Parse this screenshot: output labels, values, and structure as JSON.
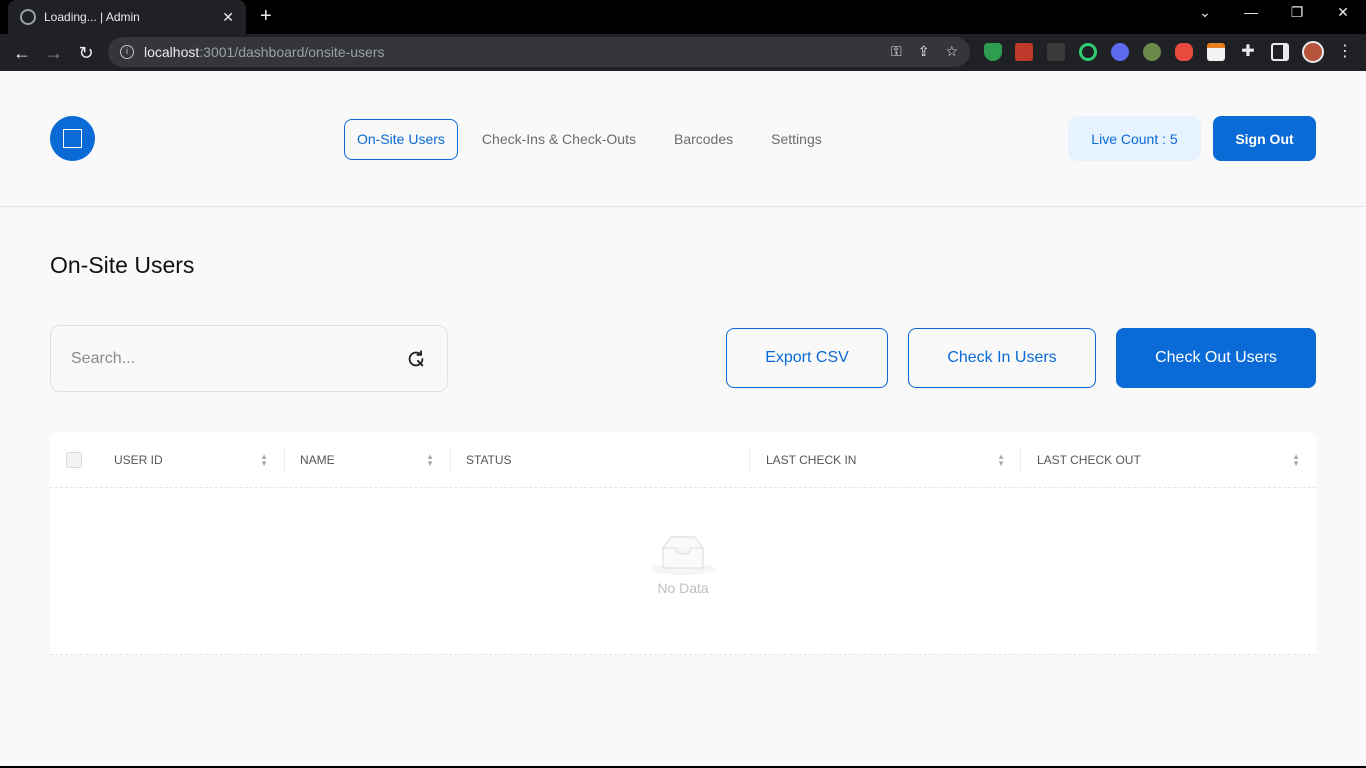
{
  "browser": {
    "tab_title": "Loading... | Admin",
    "url_host": "localhost",
    "url_path": ":3001/dashboard/onsite-users"
  },
  "nav": {
    "items": [
      {
        "label": "On-Site Users",
        "active": true
      },
      {
        "label": "Check-Ins & Check-Outs",
        "active": false
      },
      {
        "label": "Barcodes",
        "active": false
      },
      {
        "label": "Settings",
        "active": false
      }
    ]
  },
  "header": {
    "live_count": "Live Count : 5",
    "sign_out": "Sign Out"
  },
  "page": {
    "title": "On-Site Users"
  },
  "search": {
    "placeholder": "Search..."
  },
  "actions": {
    "export_csv": "Export CSV",
    "check_in": "Check In Users",
    "check_out": "Check Out Users"
  },
  "table": {
    "columns": [
      "USER ID",
      "NAME",
      "STATUS",
      "LAST CHECK IN",
      "LAST CHECK OUT"
    ],
    "empty_text": "No Data"
  },
  "colors": {
    "primary": "#0a6ad6",
    "live_bg": "#e6f3ff",
    "page_bg": "#f9f9f9"
  }
}
